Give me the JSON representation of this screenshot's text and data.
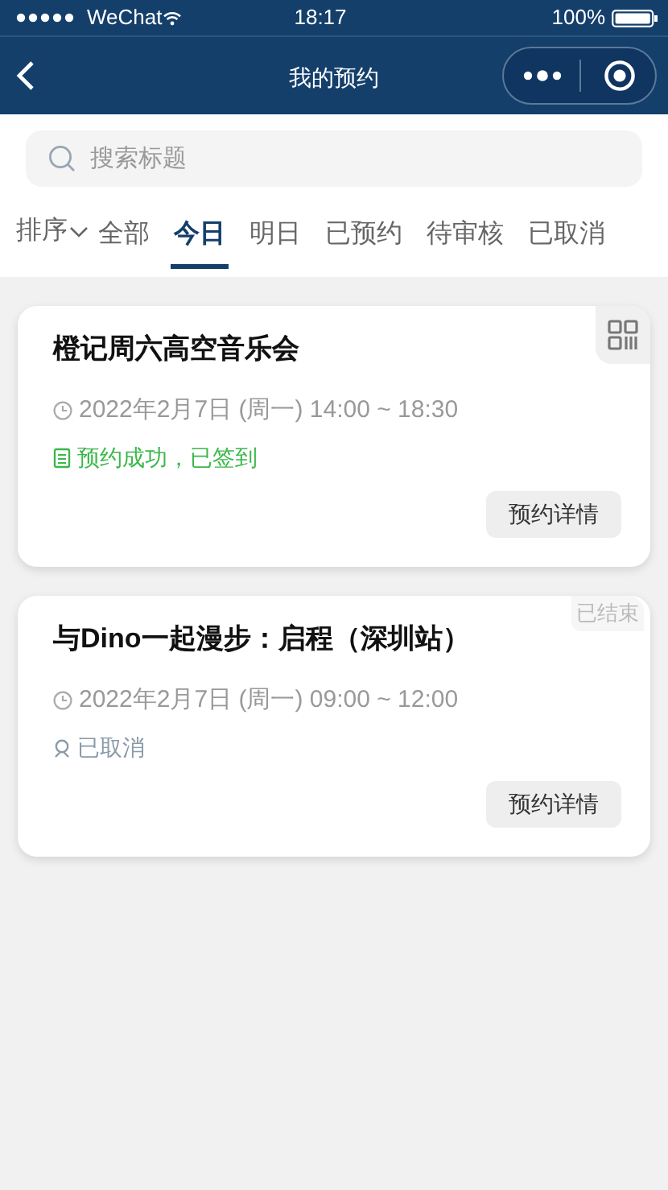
{
  "status_bar": {
    "carrier": "WeChat",
    "time": "18:17",
    "battery": "100%"
  },
  "nav": {
    "title": "我的预约"
  },
  "search": {
    "placeholder": "搜索标题"
  },
  "sort": {
    "label": "排序"
  },
  "tabs": [
    {
      "label": "全部",
      "selected": false
    },
    {
      "label": "今日",
      "selected": true
    },
    {
      "label": "明日",
      "selected": false
    },
    {
      "label": "已预约",
      "selected": false
    },
    {
      "label": "待审核",
      "selected": false
    },
    {
      "label": "已取消",
      "selected": false
    }
  ],
  "bookings": [
    {
      "title": "橙记周六高空音乐会",
      "time": "2022年2月7日 (周一) 14:00 ~ 18:30",
      "status": {
        "kind": "success",
        "text": "预约成功，已签到"
      },
      "corner": {
        "kind": "qr"
      },
      "button": "预约详情"
    },
    {
      "title": "与Dino一起漫步：启程（深圳站）",
      "time": "2022年2月7日 (周一) 09:00 ~ 12:00",
      "status": {
        "kind": "cancelled",
        "text": "已取消"
      },
      "corner": {
        "kind": "label",
        "text": "已结束"
      },
      "button": "预约详情"
    }
  ]
}
